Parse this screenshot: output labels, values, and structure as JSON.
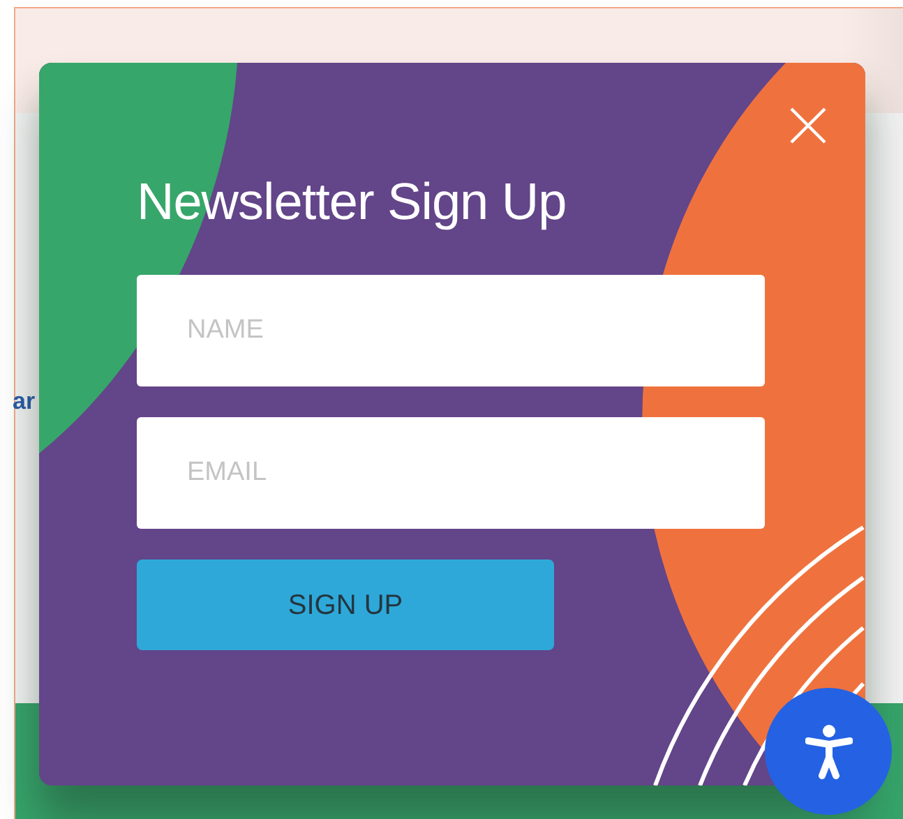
{
  "background": {
    "link_text": "ar"
  },
  "modal": {
    "title": "Newsletter Sign Up",
    "fields": [
      {
        "placeholder": "NAME"
      },
      {
        "placeholder": "EMAIL"
      }
    ],
    "submit": "SIGN UP"
  }
}
